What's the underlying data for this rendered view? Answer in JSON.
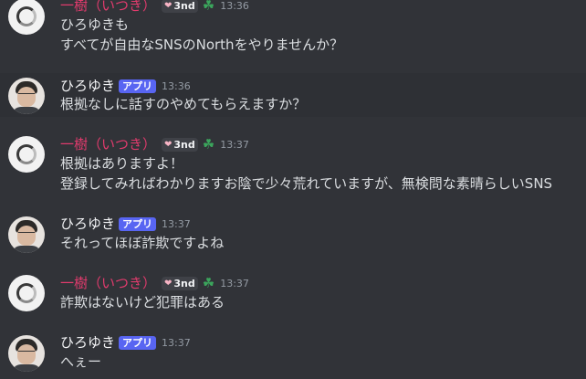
{
  "messages": [
    {
      "author": "一樹（いつき）",
      "role": "3nd",
      "time": "13:36",
      "lines": [
        "ひろゆきも",
        "すべてが自由なSNSのNorthをやりませんか？"
      ]
    },
    {
      "author": "ひろゆき",
      "badge": "アプリ",
      "time": "13:36",
      "lines": [
        "根拠なしに話すのやめてもらえますか？"
      ]
    },
    {
      "author": "一樹（いつき）",
      "role": "3nd",
      "time": "13:37",
      "lines": [
        "根拠はありますよ！",
        "登録してみればわかりますお陰で少々荒れていますが、無検問な素晴らしいSNS"
      ]
    },
    {
      "author": "ひろゆき",
      "badge": "アプリ",
      "time": "13:37",
      "lines": [
        "それってほぼ詐欺ですよね"
      ]
    },
    {
      "author": "一樹（いつき）",
      "role": "3nd",
      "time": "13:37",
      "lines": [
        "詐欺はないけど犯罪はある"
      ]
    },
    {
      "author": "ひろゆき",
      "badge": "アプリ",
      "time": "13:37",
      "lines": [
        "へぇー"
      ]
    }
  ],
  "icons": {
    "role": "heart-icon",
    "extra": "clover-icon"
  },
  "colors": {
    "background": "#313338",
    "itsuki_name": "#e13b6d",
    "app_badge": "#5865f2"
  }
}
